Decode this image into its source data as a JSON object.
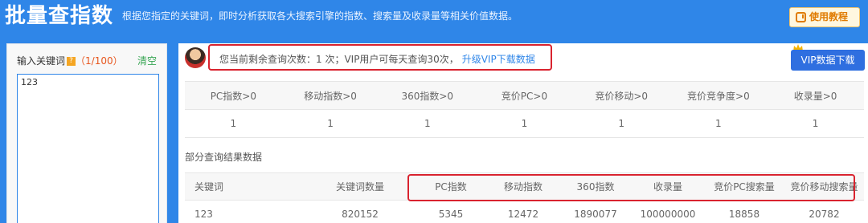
{
  "header": {
    "title": "批量查指数",
    "subtitle": "根据您指定的关键词，即时分析获取各大搜索引擎的指数、搜索量及收录量等相关价值数据。",
    "tutorial_button": "使用教程"
  },
  "sidebar": {
    "input_label": "输入关键词",
    "input_count": "（1/100）",
    "clear_label": "清空",
    "keywords_value": "123"
  },
  "notice": {
    "text": "您当前剩余查询次数：1 次；VIP用户可每天查询30次，",
    "upgrade_link": "升级VIP下载数据"
  },
  "vip_button": "VIP数据下载",
  "stats": {
    "headers": [
      "PC指数>0",
      "移动指数>0",
      "360指数>0",
      "竞价PC>0",
      "竞价移动>0",
      "竞价竞争度>0",
      "收录量>0"
    ],
    "values": [
      "1",
      "1",
      "1",
      "1",
      "1",
      "1",
      "1"
    ]
  },
  "results": {
    "section_title": "部分查询结果数据",
    "headers": [
      "关键词",
      "关键词数量",
      "PC指数",
      "移动指数",
      "360指数",
      "收录量",
      "竞价PC搜索量",
      "竞价移动搜索量"
    ],
    "rows": [
      [
        "123",
        "820152",
        "5345",
        "12472",
        "1890077",
        "100000000",
        "18858",
        "20782"
      ]
    ]
  },
  "colors": {
    "brand_blue": "#2f86e8",
    "highlight_red": "#d9232f",
    "clear_green": "#3aa655",
    "count_orange": "#e8571f"
  }
}
